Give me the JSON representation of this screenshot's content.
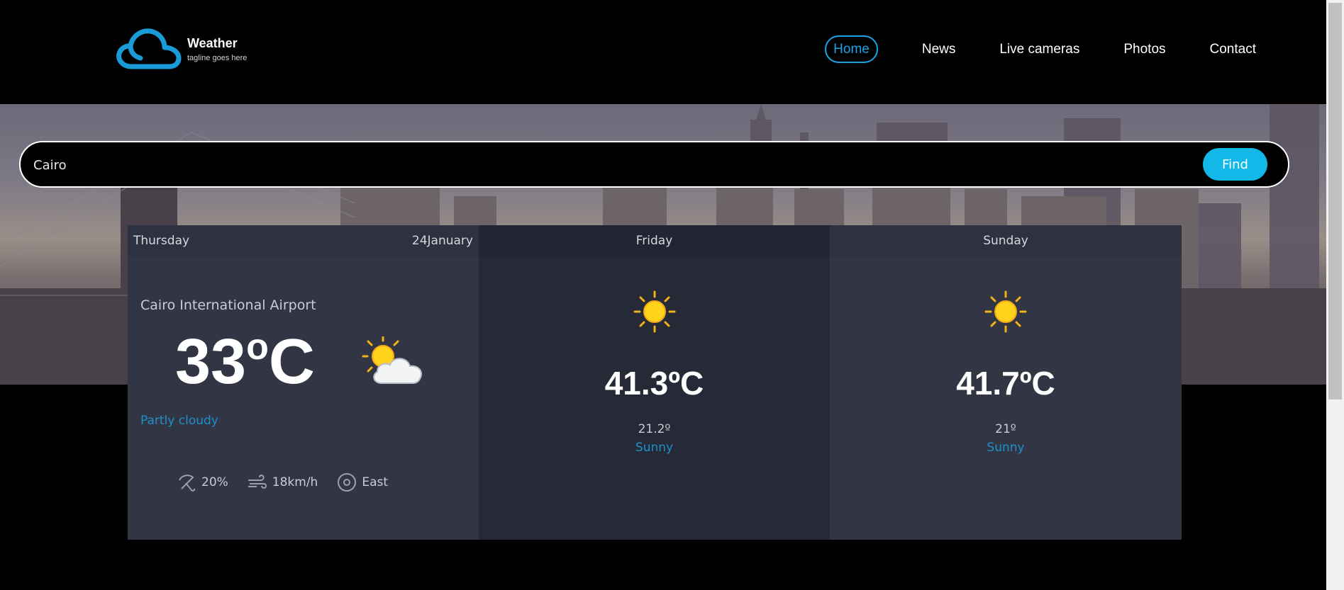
{
  "header": {
    "brand": "Weather",
    "tagline": "tagline goes here",
    "nav": [
      {
        "label": "Home",
        "active": true
      },
      {
        "label": "News"
      },
      {
        "label": "Live cameras"
      },
      {
        "label": "Photos"
      },
      {
        "label": "Contact"
      }
    ]
  },
  "search": {
    "value": "Cairo",
    "button_label": "Find"
  },
  "forecast": {
    "today": {
      "day": "Thursday",
      "date": "24January",
      "location": "Cairo International Airport",
      "temp": "33",
      "temp_unit": "o",
      "temp_unit_c": "C",
      "icon": "partly-cloudy-icon",
      "condition": "Partly cloudy",
      "rain": "20%",
      "wind": "18km/h",
      "direction": "East"
    },
    "days": [
      {
        "day": "Friday",
        "icon": "sun-icon",
        "max": "41.3ºC",
        "min": "21.2º",
        "condition": "Sunny"
      },
      {
        "day": "Sunday",
        "icon": "sun-icon",
        "max": "41.7ºC",
        "min": "21º",
        "condition": "Sunny"
      }
    ]
  },
  "colors": {
    "accent": "#1aa3e6",
    "find_button": "#12b9e8",
    "panel_light": "#323644",
    "panel_dark": "#262936"
  }
}
